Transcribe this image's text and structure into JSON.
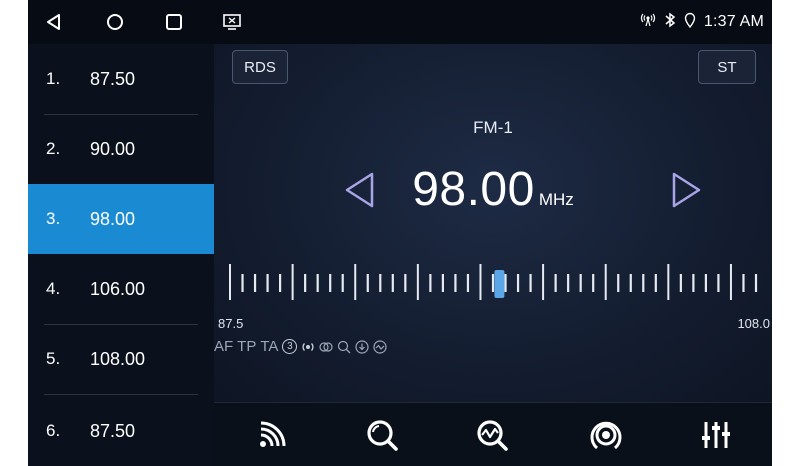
{
  "status": {
    "time": "1:37 AM"
  },
  "presets": [
    {
      "num": "1.",
      "freq": "87.50",
      "selected": false
    },
    {
      "num": "2.",
      "freq": "90.00",
      "selected": false
    },
    {
      "num": "3.",
      "freq": "98.00",
      "selected": true
    },
    {
      "num": "4.",
      "freq": "106.00",
      "selected": false
    },
    {
      "num": "5.",
      "freq": "108.00",
      "selected": false
    },
    {
      "num": "6.",
      "freq": "87.50",
      "selected": false
    }
  ],
  "radio": {
    "rds_label": "RDS",
    "st_label": "ST",
    "band": "FM-1",
    "frequency": "98.00",
    "unit": "MHz",
    "scale_min": "87.5",
    "scale_max": "108.0",
    "tuned_value": 98.0,
    "range": [
      87.5,
      108.0
    ]
  },
  "flags": {
    "af": "AF",
    "tp": "TP",
    "ta": "TA",
    "loc": "3"
  },
  "colors": {
    "accent": "#1a8bd2",
    "background": "#0c1320",
    "arrow": "#a9a4e6"
  },
  "toolbar_icons": [
    "scan-icon",
    "search-icon",
    "seek-icon",
    "broadcast-icon",
    "equalizer-icon"
  ]
}
